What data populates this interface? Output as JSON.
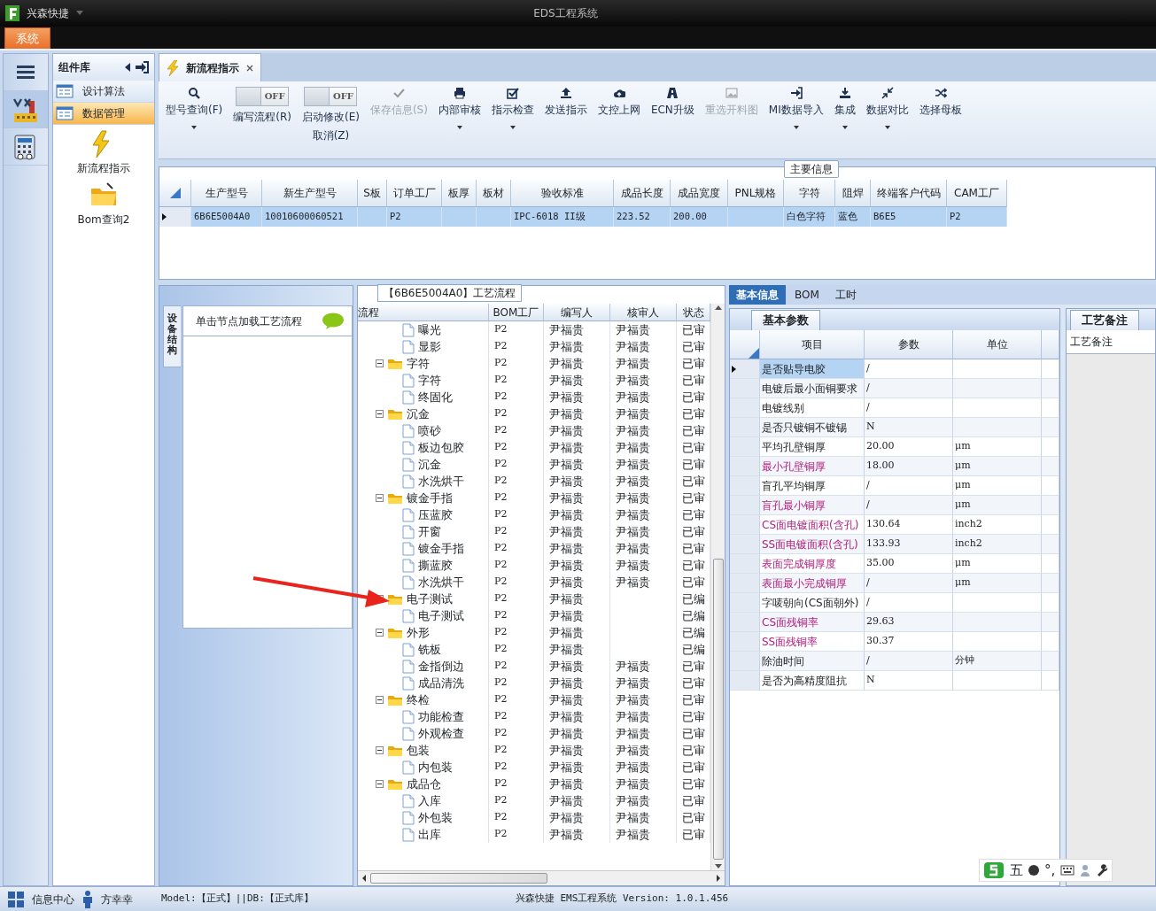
{
  "title_bar": {
    "app_name": "兴森快捷",
    "window_title": "EDS工程系统"
  },
  "menu": [
    {
      "label": "系统",
      "selected": true
    }
  ],
  "left_strip": {
    "items": [
      {
        "selected": false
      },
      {
        "selected": true
      },
      {
        "selected": false
      }
    ]
  },
  "component_panel": {
    "title": "组件库",
    "items": [
      {
        "label": "设计算法",
        "selected": false
      },
      {
        "label": "数据管理",
        "selected": true
      }
    ],
    "tools": [
      {
        "label": "新流程指示"
      },
      {
        "label": "Bom查询2"
      }
    ]
  },
  "doc_tabs": [
    {
      "label": "新流程指示",
      "selected": true
    }
  ],
  "toolbar": [
    {
      "kind": "button",
      "label": "型号查询(F)",
      "dropdown": true,
      "disabled": false
    },
    {
      "kind": "toggle",
      "label": "编写流程(R)",
      "state_text": "OFF",
      "on": false
    },
    {
      "kind": "toggle",
      "label": "启动修改(E)",
      "sublabel": "取消(Z)",
      "state_text": "OFF",
      "on": false
    },
    {
      "kind": "button",
      "label": "保存信息(S)",
      "dropdown": false,
      "disabled": true
    },
    {
      "kind": "button",
      "label": "内部审核",
      "dropdown": true,
      "disabled": false
    },
    {
      "kind": "button",
      "label": "指示检查",
      "dropdown": true,
      "disabled": false
    },
    {
      "kind": "button",
      "label": "发送指示",
      "dropdown": false,
      "disabled": false
    },
    {
      "kind": "button",
      "label": "文控上网",
      "dropdown": false,
      "disabled": false
    },
    {
      "kind": "button",
      "label": "ECN升级",
      "dropdown": false,
      "disabled": false
    },
    {
      "kind": "button",
      "label": "重选开料图",
      "dropdown": false,
      "disabled": true
    },
    {
      "kind": "button",
      "label": "MI数据导入",
      "dropdown": true,
      "disabled": false
    },
    {
      "kind": "button",
      "label": "集成",
      "dropdown": true,
      "disabled": false
    },
    {
      "kind": "button",
      "label": "数据对比",
      "dropdown": true,
      "disabled": false
    },
    {
      "kind": "button",
      "label": "选择母板",
      "dropdown": false,
      "disabled": false
    }
  ],
  "main_info": {
    "title": "主要信息",
    "columns": [
      "生产型号",
      "新生产型号",
      "S板",
      "订单工厂",
      "板厚",
      "板材",
      "验收标准",
      "成品长度",
      "成品宽度",
      "PNL规格",
      "字符",
      "阻焊",
      "终端客户代码",
      "CAM工厂"
    ],
    "rows": [
      {
        "selected": true,
        "cells": [
          "6B6E5004A0",
          "10010600060521",
          "",
          "P2",
          "",
          "",
          "IPC-6018 II级",
          "223.52",
          "200.00",
          "",
          "白色字符",
          "蓝色",
          "B6E5",
          "P2"
        ]
      }
    ]
  },
  "structure_panel": {
    "side_tab": "设备结构",
    "hint": "单击节点加载工艺流程"
  },
  "process_flow": {
    "title": "【6B6E5004A0】工艺流程",
    "columns": [
      "流程",
      "BOM工厂",
      "编写人",
      "核审人",
      "状态"
    ],
    "nodes": [
      {
        "children": [
          {
            "kind": "leaf",
            "label": "曝光",
            "factory": "P2",
            "writer": "尹福贵",
            "reviewer": "尹福贵",
            "status": "已审"
          },
          {
            "kind": "leaf",
            "label": "显影",
            "factory": "P2",
            "writer": "尹福贵",
            "reviewer": "尹福贵",
            "status": "已审"
          }
        ]
      },
      {
        "kind": "folder",
        "expanded": true,
        "label": "字符",
        "factory": "P2",
        "writer": "尹福贵",
        "reviewer": "尹福贵",
        "status": "已审",
        "children": [
          {
            "kind": "leaf",
            "label": "字符",
            "factory": "P2",
            "writer": "尹福贵",
            "reviewer": "尹福贵",
            "status": "已审"
          },
          {
            "kind": "leaf",
            "label": "终固化",
            "factory": "P2",
            "writer": "尹福贵",
            "reviewer": "尹福贵",
            "status": "已审"
          }
        ]
      },
      {
        "kind": "folder",
        "expanded": true,
        "label": "沉金",
        "factory": "P2",
        "writer": "尹福贵",
        "reviewer": "尹福贵",
        "status": "已审",
        "children": [
          {
            "kind": "leaf",
            "label": "喷砂",
            "factory": "P2",
            "writer": "尹福贵",
            "reviewer": "尹福贵",
            "status": "已审"
          },
          {
            "kind": "leaf",
            "label": "板边包胶",
            "factory": "P2",
            "writer": "尹福贵",
            "reviewer": "尹福贵",
            "status": "已审"
          },
          {
            "kind": "leaf",
            "label": "沉金",
            "factory": "P2",
            "writer": "尹福贵",
            "reviewer": "尹福贵",
            "status": "已审"
          },
          {
            "kind": "leaf",
            "label": "水洗烘干",
            "factory": "P2",
            "writer": "尹福贵",
            "reviewer": "尹福贵",
            "status": "已审"
          }
        ]
      },
      {
        "kind": "folder",
        "expanded": true,
        "label": "镀金手指",
        "factory": "P2",
        "writer": "尹福贵",
        "reviewer": "尹福贵",
        "status": "已审",
        "children": [
          {
            "kind": "leaf",
            "label": "压蓝胶",
            "factory": "P2",
            "writer": "尹福贵",
            "reviewer": "尹福贵",
            "status": "已审"
          },
          {
            "kind": "leaf",
            "label": "开窗",
            "factory": "P2",
            "writer": "尹福贵",
            "reviewer": "尹福贵",
            "status": "已审"
          },
          {
            "kind": "leaf",
            "label": "镀金手指",
            "factory": "P2",
            "writer": "尹福贵",
            "reviewer": "尹福贵",
            "status": "已审"
          },
          {
            "kind": "leaf",
            "label": "撕蓝胶",
            "factory": "P2",
            "writer": "尹福贵",
            "reviewer": "尹福贵",
            "status": "已审"
          },
          {
            "kind": "leaf",
            "label": "水洗烘干",
            "factory": "P2",
            "writer": "尹福贵",
            "reviewer": "尹福贵",
            "status": "已审"
          }
        ]
      },
      {
        "kind": "folder",
        "expanded": true,
        "label": "电子测试",
        "factory": "P2",
        "writer": "尹福贵",
        "status": "已编",
        "children": [
          {
            "kind": "leaf",
            "label": "电子测试",
            "factory": "P2",
            "writer": "尹福贵",
            "status": "已编"
          }
        ]
      },
      {
        "kind": "folder",
        "expanded": true,
        "label": "外形",
        "factory": "P2",
        "writer": "尹福贵",
        "status": "已编",
        "children": [
          {
            "kind": "leaf",
            "label": "铣板",
            "factory": "P2",
            "writer": "尹福贵",
            "status": "已编"
          },
          {
            "kind": "leaf",
            "label": "金指倒边",
            "factory": "P2",
            "writer": "尹福贵",
            "reviewer": "尹福贵",
            "status": "已审"
          },
          {
            "kind": "leaf",
            "label": "成品清洗",
            "factory": "P2",
            "writer": "尹福贵",
            "reviewer": "尹福贵",
            "status": "已审"
          }
        ]
      },
      {
        "kind": "folder",
        "expanded": true,
        "label": "终检",
        "factory": "P2",
        "writer": "尹福贵",
        "reviewer": "尹福贵",
        "status": "已审",
        "children": [
          {
            "kind": "leaf",
            "label": "功能检查",
            "factory": "P2",
            "writer": "尹福贵",
            "reviewer": "尹福贵",
            "status": "已审"
          },
          {
            "kind": "leaf",
            "label": "外观检查",
            "factory": "P2",
            "writer": "尹福贵",
            "reviewer": "尹福贵",
            "status": "已审"
          }
        ]
      },
      {
        "kind": "folder",
        "expanded": true,
        "label": "包装",
        "factory": "P2",
        "writer": "尹福贵",
        "reviewer": "尹福贵",
        "status": "已审",
        "children": [
          {
            "kind": "leaf",
            "label": "内包装",
            "factory": "P2",
            "writer": "尹福贵",
            "reviewer": "尹福贵",
            "status": "已审"
          }
        ]
      },
      {
        "kind": "folder",
        "expanded": true,
        "label": "成品仓",
        "factory": "P2",
        "writer": "尹福贵",
        "reviewer": "尹福贵",
        "status": "已审",
        "children": [
          {
            "kind": "leaf",
            "label": "入库",
            "factory": "P2",
            "writer": "尹福贵",
            "reviewer": "尹福贵",
            "status": "已审"
          },
          {
            "kind": "leaf",
            "label": "外包装",
            "factory": "P2",
            "writer": "尹福贵",
            "reviewer": "尹福贵",
            "status": "已审"
          },
          {
            "kind": "leaf",
            "label": "出库",
            "factory": "P2",
            "writer": "尹福贵",
            "reviewer": "尹福贵",
            "status": "已审"
          }
        ]
      }
    ]
  },
  "detail_tabs": [
    {
      "label": "基本信息",
      "selected": true
    },
    {
      "label": "BOM",
      "selected": false
    },
    {
      "label": "工时",
      "selected": false
    }
  ],
  "basic_params": {
    "title": "基本参数",
    "columns": [
      "项目",
      "参数",
      "单位"
    ],
    "rows": [
      {
        "item": "是否贴导电胶",
        "value": "/",
        "selected": true,
        "highlight": false
      },
      {
        "item": "电镀后最小面铜要求",
        "value": "/",
        "selected": false,
        "highlight": false
      },
      {
        "item": "电镀线别",
        "value": "/",
        "selected": false,
        "highlight": false
      },
      {
        "item": "是否只镀铜不镀锡",
        "value": "N",
        "selected": false,
        "highlight": false
      },
      {
        "item": "平均孔壁铜厚",
        "value": "20.00",
        "unit": "μm",
        "selected": false,
        "highlight": false
      },
      {
        "item": "最小孔壁铜厚",
        "value": "18.00",
        "unit": "μm",
        "selected": false,
        "highlight": true
      },
      {
        "item": "盲孔平均铜厚",
        "value": "/",
        "unit": "μm",
        "selected": false,
        "highlight": false
      },
      {
        "item": "盲孔最小铜厚",
        "value": "/",
        "unit": "μm",
        "selected": false,
        "highlight": true
      },
      {
        "item": "CS面电镀面积(含孔)",
        "value": "130.64",
        "unit": "inch2",
        "selected": false,
        "highlight": true
      },
      {
        "item": "SS面电镀面积(含孔)",
        "value": "133.93",
        "unit": "inch2",
        "selected": false,
        "highlight": true
      },
      {
        "item": "表面完成铜厚度",
        "value": "35.00",
        "unit": "μm",
        "selected": false,
        "highlight": true
      },
      {
        "item": "表面最小完成铜厚",
        "value": "/",
        "unit": "μm",
        "selected": false,
        "highlight": true
      },
      {
        "item": "字唛朝向(CS面朝外)",
        "value": "/",
        "selected": false,
        "highlight": false
      },
      {
        "item": "CS面残铜率",
        "value": "29.63",
        "selected": false,
        "highlight": true
      },
      {
        "item": "SS面残铜率",
        "value": "30.37",
        "selected": false,
        "highlight": true
      },
      {
        "item": "除油时间",
        "value": "/",
        "unit": "分钟",
        "selected": false,
        "highlight": false
      },
      {
        "item": "是否为高精度阻抗",
        "value": "N",
        "selected": false,
        "highlight": false
      }
    ]
  },
  "process_notes": {
    "title": "工艺备注",
    "header": "工艺备注"
  },
  "ime_bar": {
    "mode": "五",
    "punct": "°,"
  },
  "status_bar": {
    "info_center": "信息中心",
    "user": "方幸幸",
    "model": "Model:【正式】||DB:【正式库】",
    "version": "兴森快捷 EMS工程系统 Version: 1.0.1.456"
  }
}
